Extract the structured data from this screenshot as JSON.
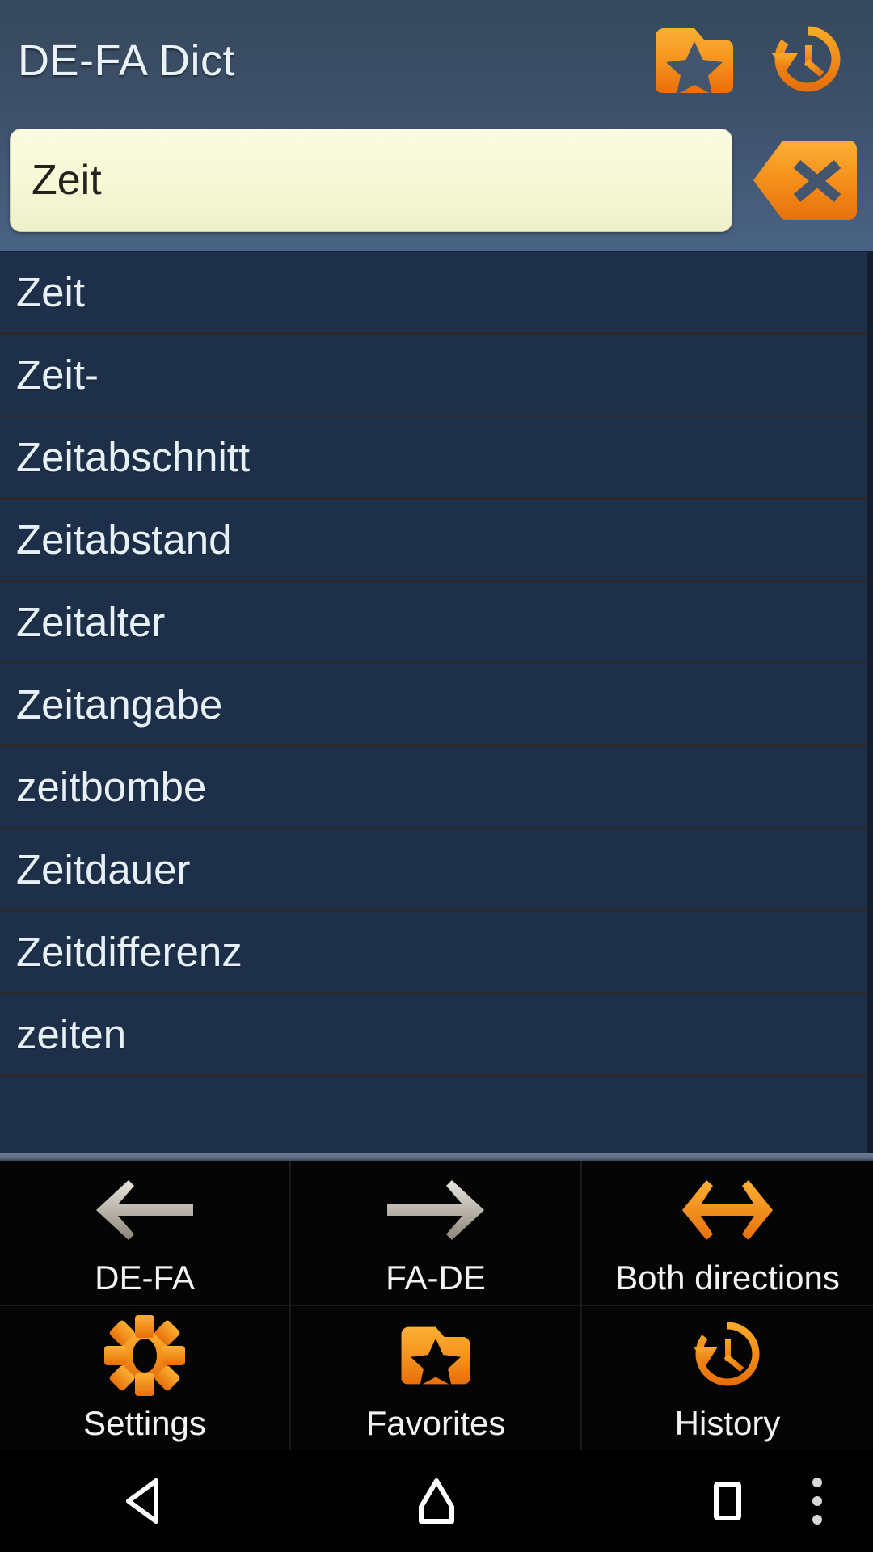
{
  "header": {
    "title": "DE-FA Dict",
    "actions": [
      {
        "name": "favorites-icon",
        "label": "Favorites"
      },
      {
        "name": "history-icon",
        "label": "History"
      }
    ]
  },
  "search": {
    "value": "Zeit",
    "placeholder": "",
    "clear_button_label": "Clear"
  },
  "results": {
    "items": [
      {
        "word": "Zeit"
      },
      {
        "word": "Zeit-"
      },
      {
        "word": "Zeitabschnitt"
      },
      {
        "word": "Zeitabstand"
      },
      {
        "word": "Zeitalter"
      },
      {
        "word": "Zeitangabe"
      },
      {
        "word": "zeitbombe"
      },
      {
        "word": "Zeitdauer"
      },
      {
        "word": "Zeitdifferenz"
      },
      {
        "word": "zeiten"
      },
      {
        "word": ""
      }
    ]
  },
  "options_menu": {
    "direction_row": [
      {
        "label": "DE-FA",
        "icon": "arrow-left-icon",
        "active": false
      },
      {
        "label": "FA-DE",
        "icon": "arrow-right-icon",
        "active": false
      },
      {
        "label": "Both directions",
        "icon": "arrow-both-icon",
        "active": true
      }
    ],
    "tools_row": [
      {
        "label": "Settings",
        "icon": "gear-icon"
      },
      {
        "label": "Favorites",
        "icon": "folder-star-icon"
      },
      {
        "label": "History",
        "icon": "clock-history-icon"
      }
    ]
  },
  "navbar": {
    "back": "Back",
    "home": "Home",
    "recents": "Recent apps",
    "overflow": "More options"
  },
  "colors": {
    "accent_orange": "#f39c12",
    "accent_orange_dark": "#e8730c",
    "header_top": "#36485c",
    "header_bottom": "#4a6384",
    "list_background": "#1e3049",
    "list_divider": "#2a2a28",
    "search_field": "#f6f7d5",
    "menu_background": "#050505",
    "inactive_arrow": "#c8c3ba"
  }
}
